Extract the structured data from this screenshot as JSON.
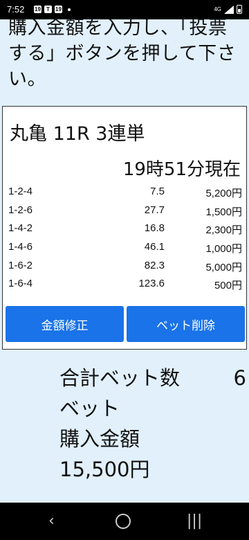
{
  "status_bar": {
    "time": "7:52",
    "notif_icons": [
      "19",
      "T",
      "19"
    ],
    "network": "4G"
  },
  "instruction_text": "購入金額を入力し、「投票する」ボタンを押して下さい。",
  "race": {
    "title": "丸亀 11R 3連単",
    "as_of": "19時51分現在"
  },
  "bets": [
    {
      "combo": "1-2-4",
      "odds": "7.5",
      "amount": "5,200円"
    },
    {
      "combo": "1-2-6",
      "odds": "27.7",
      "amount": "1,500円"
    },
    {
      "combo": "1-4-2",
      "odds": "16.8",
      "amount": "2,300円"
    },
    {
      "combo": "1-4-6",
      "odds": "46.1",
      "amount": "1,000円"
    },
    {
      "combo": "1-6-2",
      "odds": "82.3",
      "amount": "5,000円"
    },
    {
      "combo": "1-6-4",
      "odds": "123.6",
      "amount": "500円"
    }
  ],
  "buttons": {
    "edit_amount": "金額修正",
    "delete_bet": "ベット削除"
  },
  "summary": {
    "total_bets_label": "合計ベット数",
    "total_bets_value": "6",
    "bets_unit": "ベット",
    "purchase_label": "購入金額",
    "purchase_value": "15,500円"
  },
  "colors": {
    "button": "#1a73e8",
    "background": "#e1f0fb"
  },
  "nav_icons": [
    "back-icon",
    "home-icon",
    "recent-apps-icon"
  ]
}
